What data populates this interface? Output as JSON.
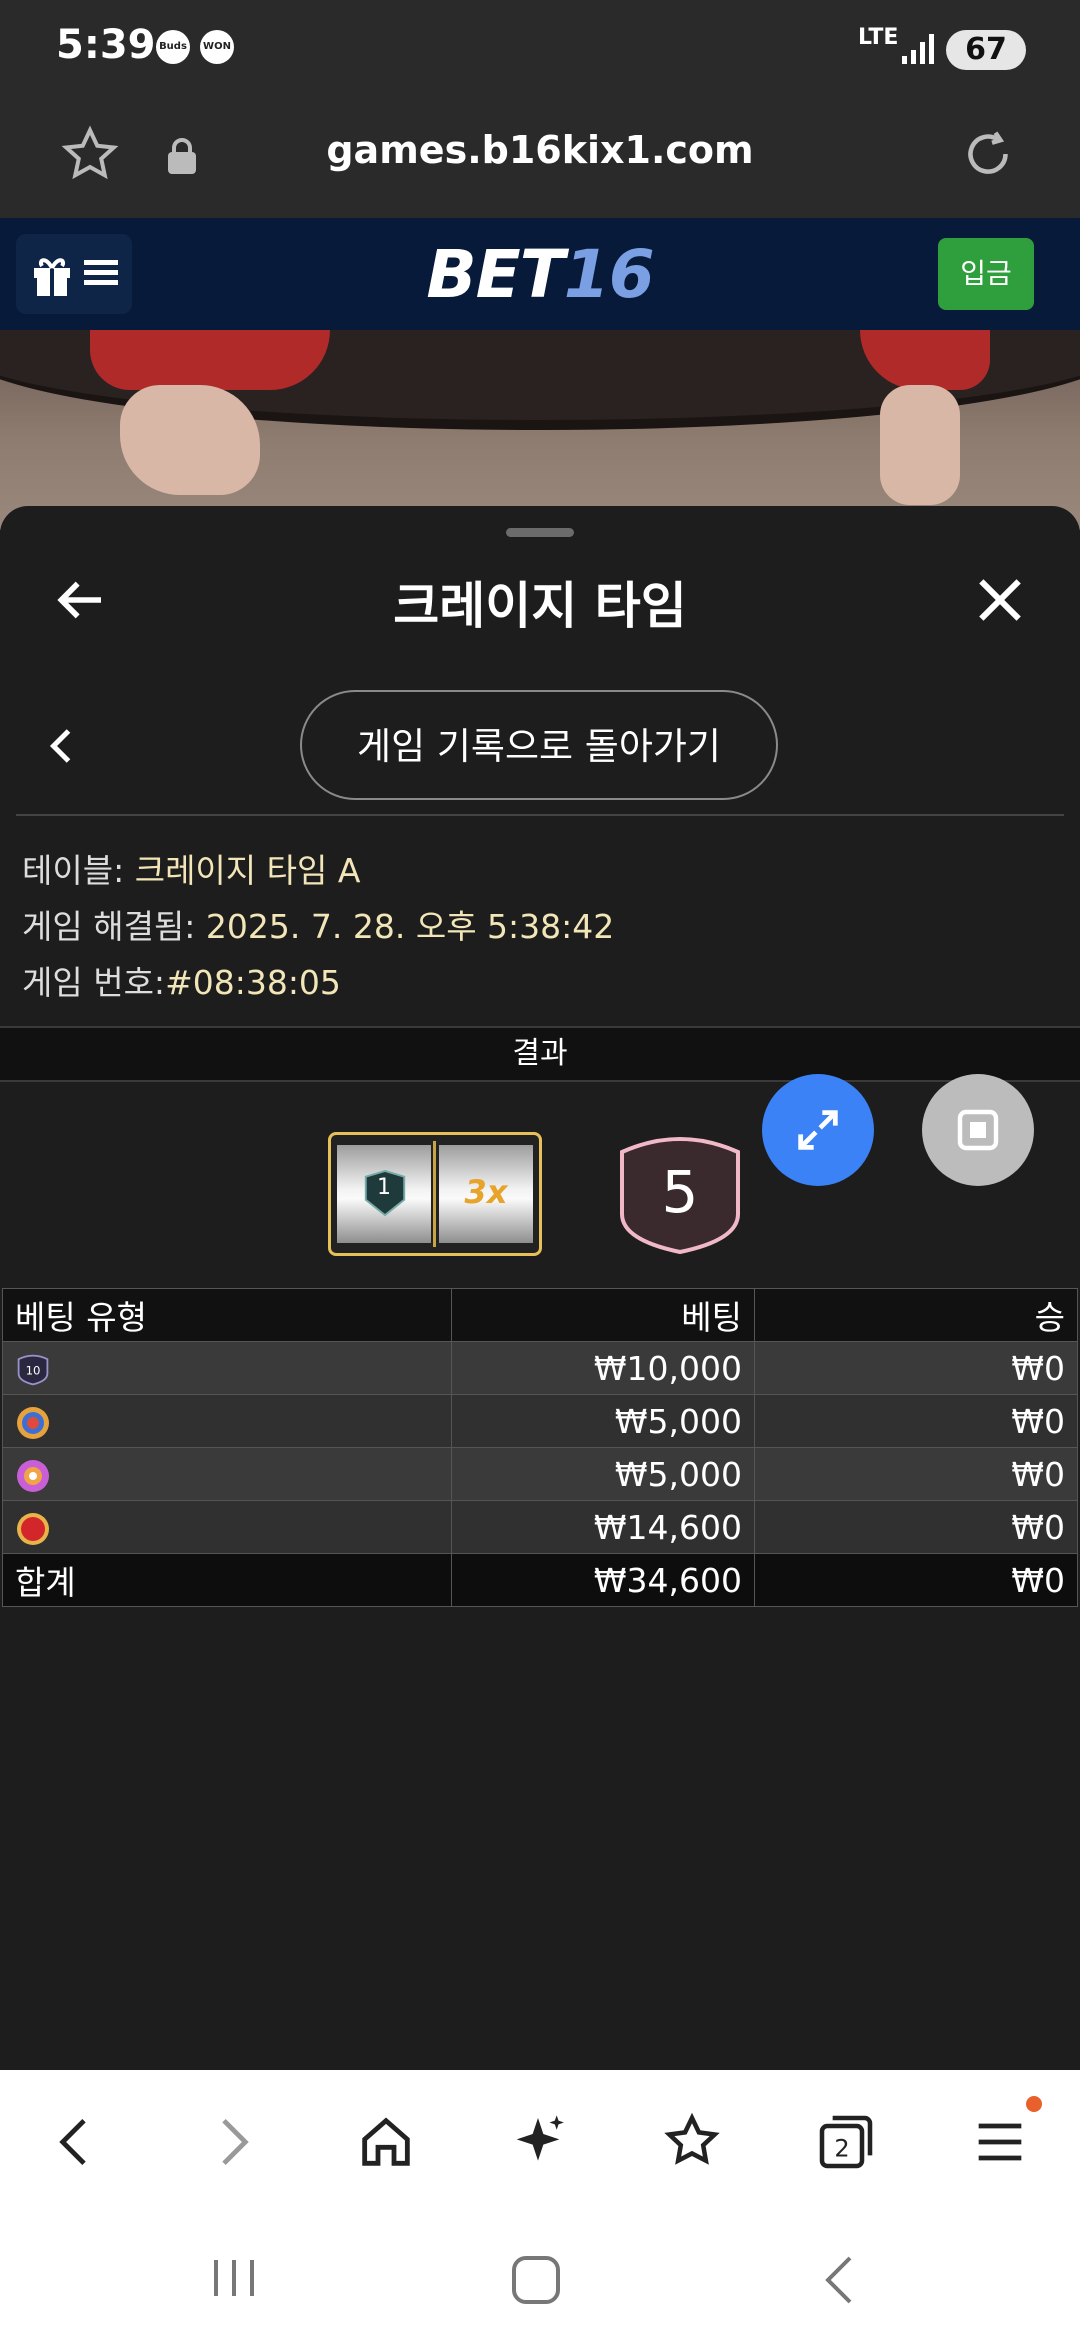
{
  "status_bar": {
    "time": "5:39",
    "badge_1": "Buds",
    "badge_2": "WON",
    "network": "LTE",
    "battery": "67"
  },
  "browser": {
    "url": "games.b16kix1.com"
  },
  "site_header": {
    "logo_part1": "BET",
    "logo_part2": "16",
    "deposit_label": "입금"
  },
  "panel": {
    "title": "크레이지 타임",
    "back_to_history_label": "게임 기록으로 돌아가기",
    "info": {
      "table_label": "테이블:",
      "table_value": "크레이지 타임 A",
      "resolved_label": "게임 해결됨:",
      "resolved_value": "2025. 7. 28. 오후 5:38:42",
      "game_no_label": "게임 번호:",
      "game_no_value": "#08:38:05"
    },
    "result_header": "결과",
    "result": {
      "slot_left": "1",
      "slot_right": "3x",
      "result_number": "5"
    }
  },
  "bets_table": {
    "headers": [
      "베팅 유형",
      "베팅",
      "승"
    ],
    "rows": [
      {
        "icon": "number-10-icon",
        "icon_text": "10",
        "bet": "₩10,000",
        "win": "₩0"
      },
      {
        "icon": "coin-flip-icon",
        "icon_text": "",
        "bet": "₩5,000",
        "win": "₩0"
      },
      {
        "icon": "pachinko-icon",
        "icon_text": "",
        "bet": "₩5,000",
        "win": "₩0"
      },
      {
        "icon": "crazy-time-icon",
        "icon_text": "",
        "bet": "₩14,600",
        "win": "₩0"
      }
    ],
    "total": {
      "label": "합계",
      "bet": "₩34,600",
      "win": "₩0"
    }
  },
  "browser_nav": {
    "tab_count": "2"
  },
  "colors": {
    "header_bg": "#071a3a",
    "deposit_green": "#2f9e3c",
    "accent_blue": "#3b82f6",
    "logo_blue": "#7b9fe3",
    "gold": "#e8c05a",
    "value_text": "#f2e6b8"
  }
}
